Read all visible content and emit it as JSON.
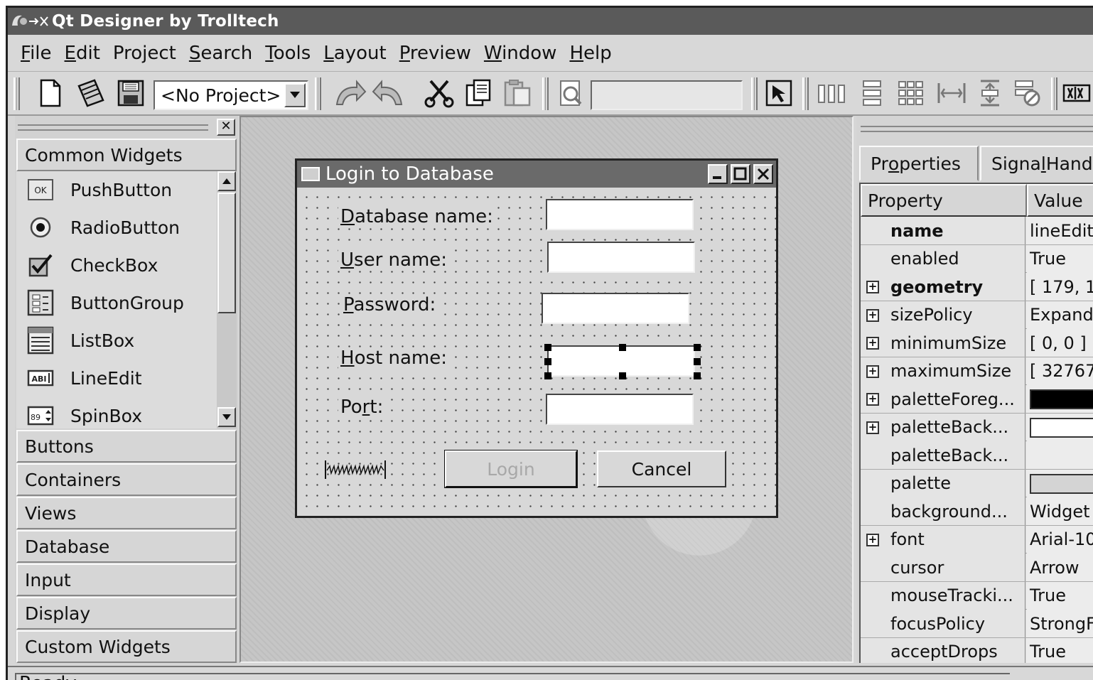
{
  "window": {
    "title": "Qt Designer by Trolltech"
  },
  "menubar": {
    "items": [
      {
        "mn": "F",
        "rest": "ile"
      },
      {
        "mn": "E",
        "rest": "dit"
      },
      {
        "pre": "Pro",
        "mn": "j",
        "rest": "ect"
      },
      {
        "mn": "S",
        "rest": "earch"
      },
      {
        "mn": "T",
        "rest": "ools"
      },
      {
        "mn": "L",
        "rest": "ayout"
      },
      {
        "mn": "P",
        "rest": "review"
      },
      {
        "mn": "W",
        "rest": "indow"
      },
      {
        "mn": "H",
        "rest": "elp"
      }
    ]
  },
  "toolbar": {
    "project_combo": "<No Project>",
    "icons": [
      "new-file-icon",
      "open-icon",
      "save-icon",
      "undo-icon",
      "redo-icon",
      "cut-icon",
      "copy-icon",
      "paste-icon",
      "find-icon",
      "pointer-icon",
      "layout-horizontal-icon",
      "layout-vertical-icon",
      "layout-grid-icon",
      "adjust-size-icon",
      "spacer-icon",
      "break-layout-icon",
      "splitter-icon"
    ]
  },
  "toolbox": {
    "sections": [
      "Common Widgets",
      "Buttons",
      "Containers",
      "Views",
      "Database",
      "Input",
      "Display",
      "Custom Widgets"
    ],
    "common_widgets": [
      {
        "label": "PushButton",
        "icon": "pushbutton-icon"
      },
      {
        "label": "RadioButton",
        "icon": "radiobutton-icon"
      },
      {
        "label": "CheckBox",
        "icon": "checkbox-icon"
      },
      {
        "label": "ButtonGroup",
        "icon": "buttongroup-icon"
      },
      {
        "label": "ListBox",
        "icon": "listbox-icon"
      },
      {
        "label": "LineEdit",
        "icon": "lineedit-icon"
      },
      {
        "label": "SpinBox",
        "icon": "spinbox-icon"
      }
    ]
  },
  "form": {
    "title": "Login to Database",
    "labels": [
      {
        "mn": "D",
        "rest": "atabase name:"
      },
      {
        "mn": "U",
        "rest": "ser name:"
      },
      {
        "mn": "P",
        "rest": "assword:"
      },
      {
        "mn": "H",
        "rest": "ost name:"
      },
      {
        "pre": "Po",
        "mn": "r",
        "rest": "t:"
      }
    ],
    "login_button": "Login",
    "cancel_button": "Cancel"
  },
  "property_editor": {
    "tabs": [
      {
        "pre": "Pr",
        "mn": "o",
        "rest": "perties"
      },
      {
        "pre": "Signa",
        "mn": "l",
        "rest": " Hand"
      }
    ],
    "col_property": "Property",
    "col_value": "Value",
    "rows": [
      {
        "name": "name",
        "value": "lineEdit",
        "bold": true,
        "expandable": false
      },
      {
        "name": "enabled",
        "value": "True",
        "bold": false,
        "expandable": false
      },
      {
        "name": "geometry",
        "value": "[ 179, 1",
        "bold": true,
        "expandable": true
      },
      {
        "name": "sizePolicy",
        "value": "Expand",
        "bold": false,
        "expandable": true
      },
      {
        "name": "minimumSize",
        "value": "[ 0, 0 ]",
        "bold": false,
        "expandable": true
      },
      {
        "name": "maximumSize",
        "value": "[ 32767",
        "bold": false,
        "expandable": true
      },
      {
        "name": "paletteForeg...",
        "value": "",
        "bold": false,
        "expandable": true,
        "swatch": "#000000"
      },
      {
        "name": "paletteBack...",
        "value": "",
        "bold": false,
        "expandable": true,
        "swatch": "#ffffff"
      },
      {
        "name": "paletteBack...",
        "value": "",
        "bold": false,
        "expandable": false
      },
      {
        "name": "palette",
        "value": "",
        "bold": false,
        "expandable": false,
        "swatch": "#d4d4d4"
      },
      {
        "name": "background...",
        "value": "Widget",
        "bold": false,
        "expandable": false
      },
      {
        "name": "font",
        "value": "Arial-10",
        "bold": false,
        "expandable": true
      },
      {
        "name": "cursor",
        "value": "Arrow",
        "bold": false,
        "expandable": false
      },
      {
        "name": "mouseTracki...",
        "value": "True",
        "bold": false,
        "expandable": false
      },
      {
        "name": "focusPolicy",
        "value": "StrongF",
        "bold": false,
        "expandable": false
      },
      {
        "name": "acceptDrops",
        "value": "True",
        "bold": false,
        "expandable": false
      }
    ]
  },
  "statusbar": {
    "text": "Ready"
  }
}
